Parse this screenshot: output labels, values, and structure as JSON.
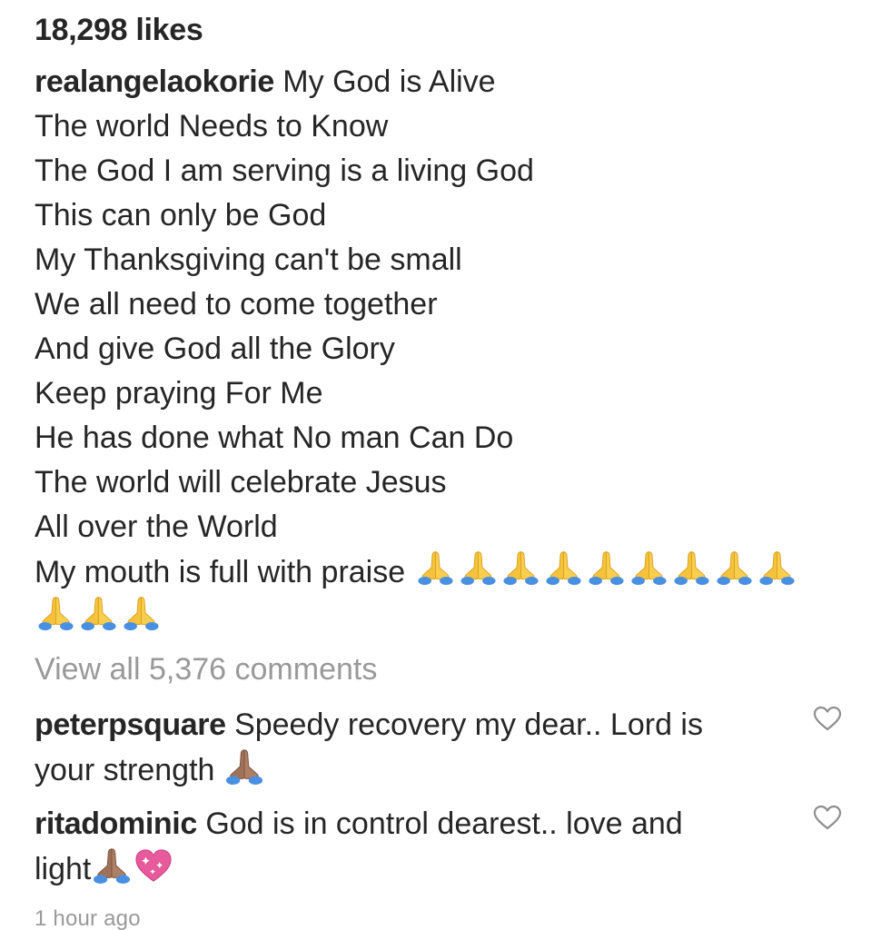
{
  "post": {
    "likes": "18,298 likes",
    "caption_user": "realangelaokorie",
    "caption_first": "My God is Alive",
    "caption_lines": [
      "The world Needs to Know",
      "The God I am serving is a living God",
      "This can only be God",
      "My Thanksgiving can't be small",
      "We all need to come together",
      "And give God all the Glory",
      "Keep praying For Me",
      "He has done what No man Can Do",
      "The world will celebrate Jesus",
      "All over the World"
    ],
    "caption_last": "My mouth is full with praise",
    "caption_emoji": "folded-hands-icon",
    "caption_emoji_count": 12,
    "view_all": "View all 5,376 comments",
    "comments": [
      {
        "user": "peterpsquare",
        "text_a": "Speedy recovery my dear.. Lord is",
        "text_b": "your strength",
        "emojis": [
          "folded-hands-medium-dark-icon"
        ],
        "like_icon": "heart-outline-icon"
      },
      {
        "user": "ritadominic",
        "text_a": "God is in control dearest.. love and",
        "text_b": "light",
        "emojis": [
          "folded-hands-medium-dark-icon",
          "sparkling-heart-icon"
        ],
        "like_icon": "heart-outline-icon"
      }
    ],
    "timestamp": "1 hour ago"
  },
  "colors": {
    "text": "#262626",
    "muted": "#999999",
    "emoji_yellow": "#F5C33B",
    "emoji_sleeve": "#4A90E2",
    "emoji_brown": "#A0725A",
    "sparkle_pink": "#E75A9B"
  }
}
